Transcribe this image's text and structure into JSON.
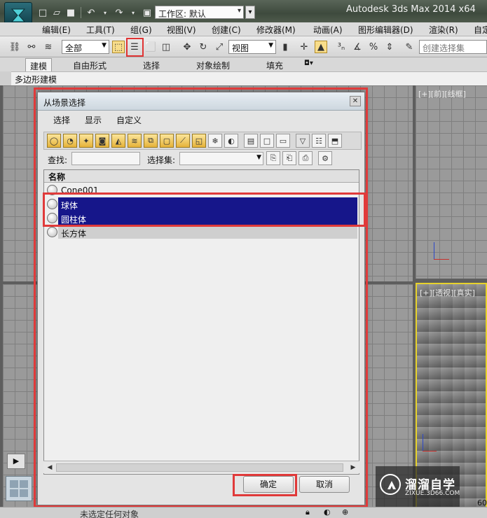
{
  "titlebar": {
    "workspace_label": "工作区: 默认",
    "app_title": "Autodesk 3ds Max  2014 x64"
  },
  "menu": [
    "编辑(E)",
    "工具(T)",
    "组(G)",
    "视图(V)",
    "创建(C)",
    "修改器(M)",
    "动画(A)",
    "图形编辑器(D)",
    "渲染(R)",
    "自定"
  ],
  "toolbar": {
    "filter_value": "全部",
    "coord_value": "视图",
    "selection_set_placeholder": "创建选择集"
  },
  "ribbon": {
    "tabs": [
      "建模",
      "自由形式",
      "选择",
      "对象绘制",
      "填充"
    ],
    "panel_label": "多边形建模"
  },
  "viewports": {
    "top_right_label": "[+][前][线框]",
    "persp_label": "[+][透视][真实]"
  },
  "dialog": {
    "title": "从场景选择",
    "menu": [
      "选择",
      "显示",
      "自定义"
    ],
    "find_label": "查找:",
    "selection_set_label": "选择集:",
    "column_header": "名称",
    "objects": [
      {
        "name": "Cone001",
        "state": "normal"
      },
      {
        "name": "球体",
        "state": "selected"
      },
      {
        "name": "圆柱体",
        "state": "selected"
      },
      {
        "name": "长方体",
        "state": "normal"
      }
    ],
    "ok_label": "确定",
    "cancel_label": "取消"
  },
  "status": {
    "prompt": "未选定任何对象",
    "timeline_number": "60"
  },
  "watermark": {
    "title": "溜溜自学",
    "subtitle": "ZIXUE.3D66.COM"
  },
  "colors": {
    "selection_blue": "#16168a",
    "highlight_red": "#e03a3a",
    "persp_border": "#e7d22b"
  }
}
